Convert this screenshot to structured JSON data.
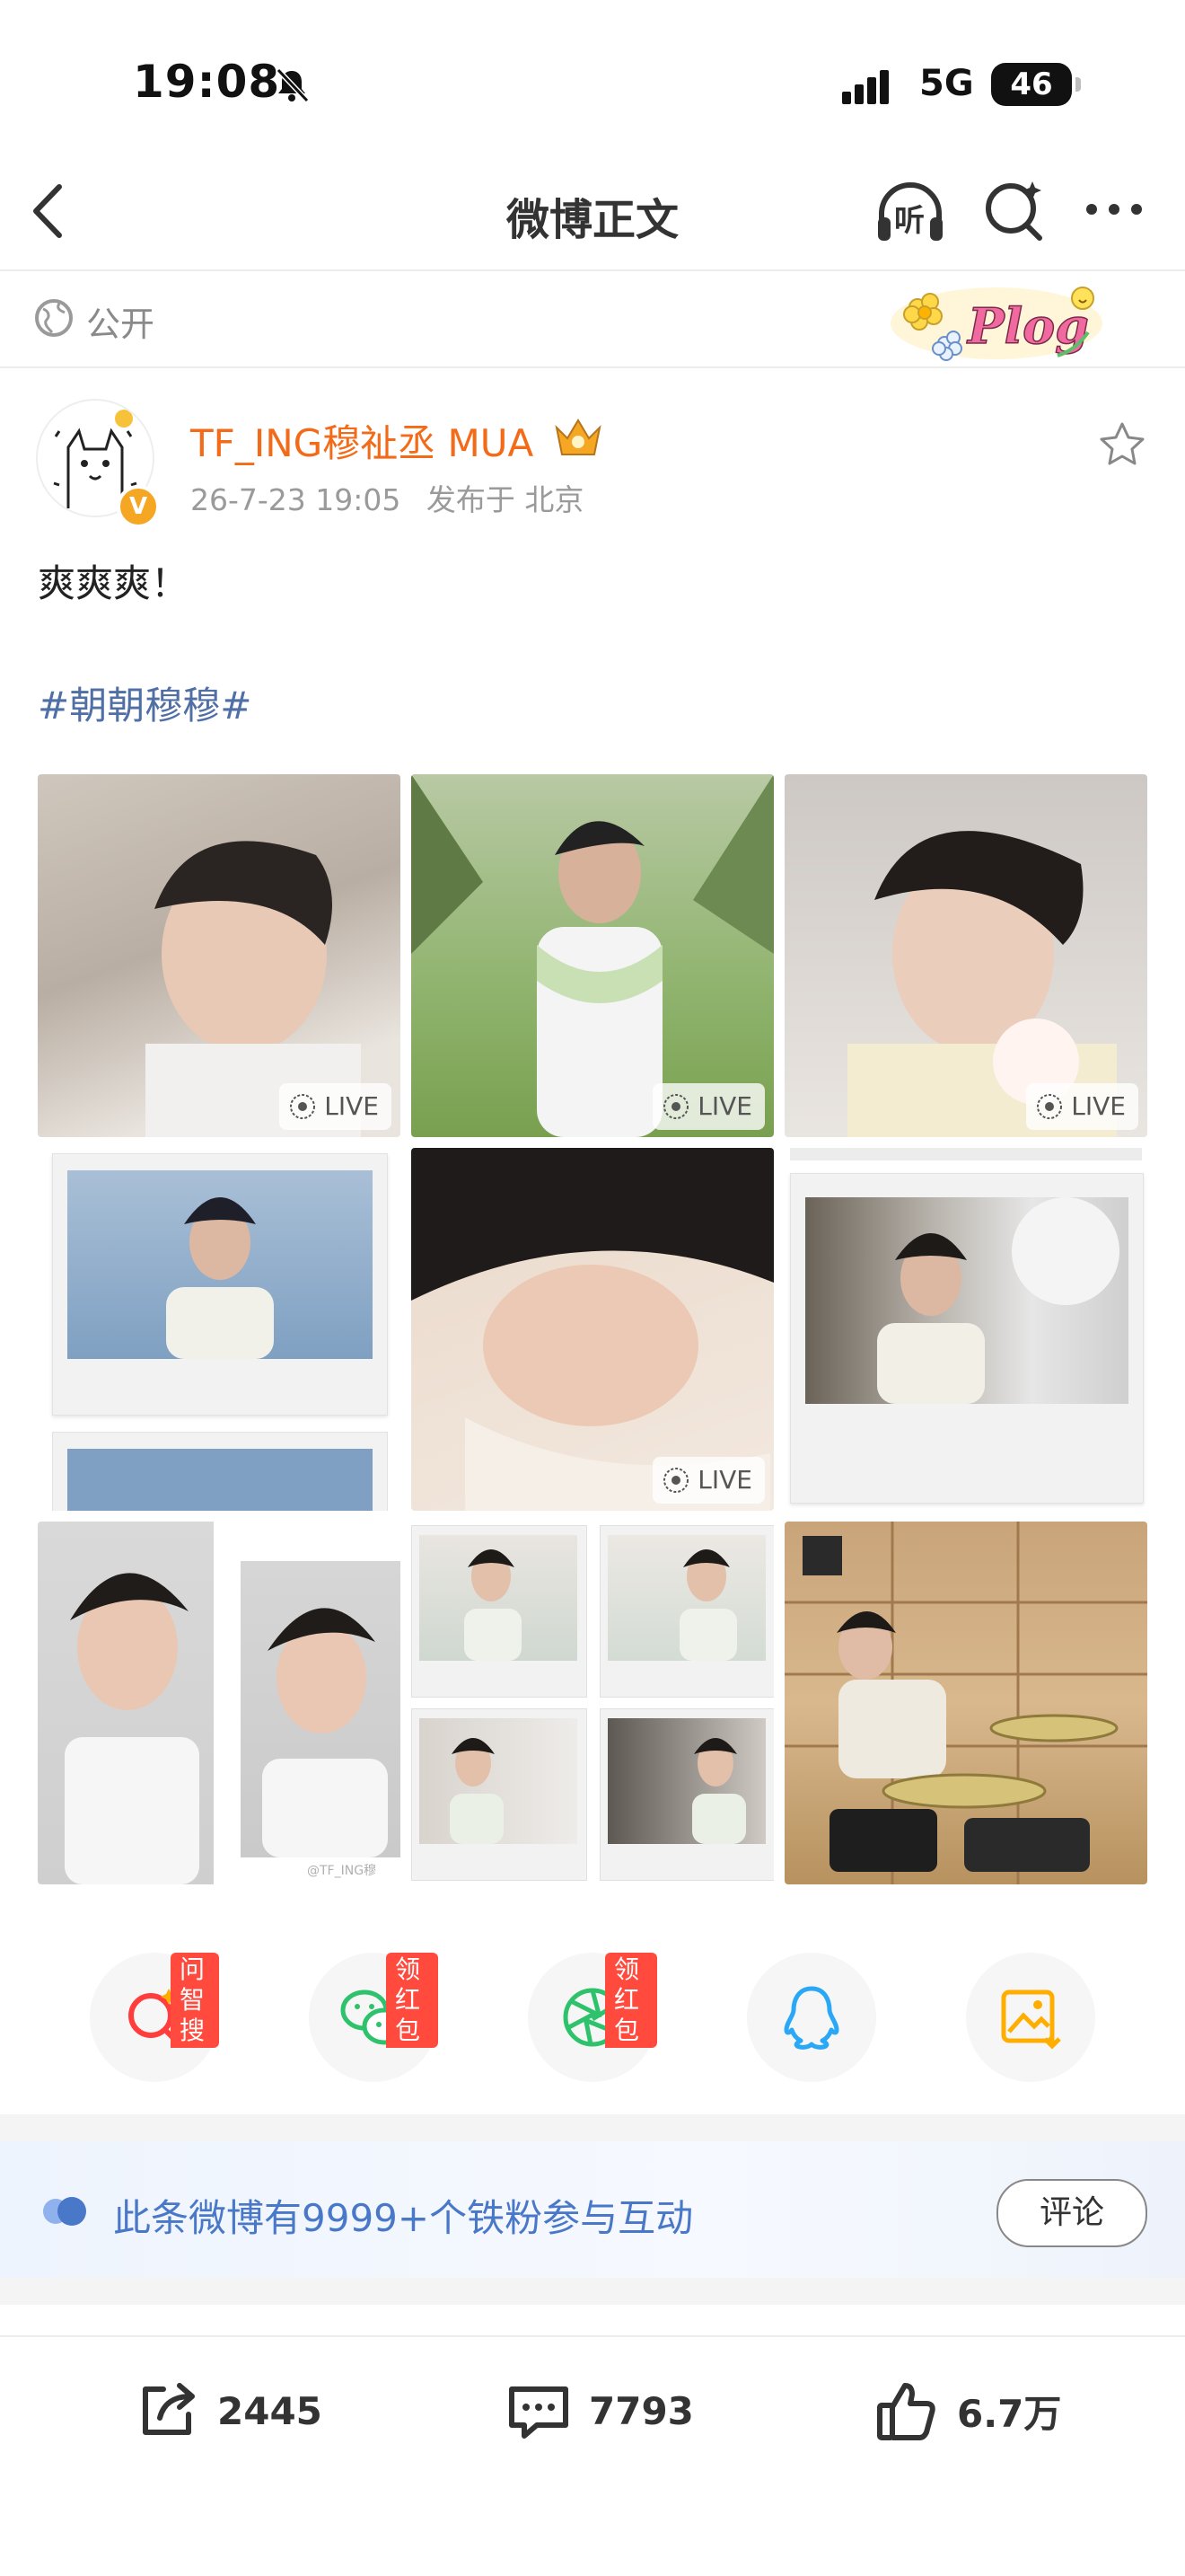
{
  "status_bar": {
    "time": "19:08",
    "network": "5G",
    "battery": "46"
  },
  "nav": {
    "title": "微博正文",
    "listen_label": "听"
  },
  "visibility": {
    "label": "公开"
  },
  "plog_sticker": "Plog",
  "post": {
    "author": "TF_ING穆祉丞 MUA",
    "timestamp": "26-7-23 19:05",
    "location": "发布于 北京",
    "text": "爽爽爽！",
    "hashtag": "#朝朝穆穆#",
    "live_label": "LIVE",
    "watermark": "@TF_ING穆"
  },
  "share_row": {
    "tags": [
      "问智搜",
      "领红包",
      "领红包"
    ]
  },
  "fans_banner": {
    "text": "此条微博有9999+个铁粉参与互动",
    "button": "评论"
  },
  "actions": {
    "repost_count": "2445",
    "comment_count": "7793",
    "like_count": "6.7万"
  },
  "colors": {
    "author": "#f36b18",
    "hashtag": "#4f6fa5",
    "banner_text": "#4a78c9",
    "tag_red": "#ff4a3d"
  }
}
